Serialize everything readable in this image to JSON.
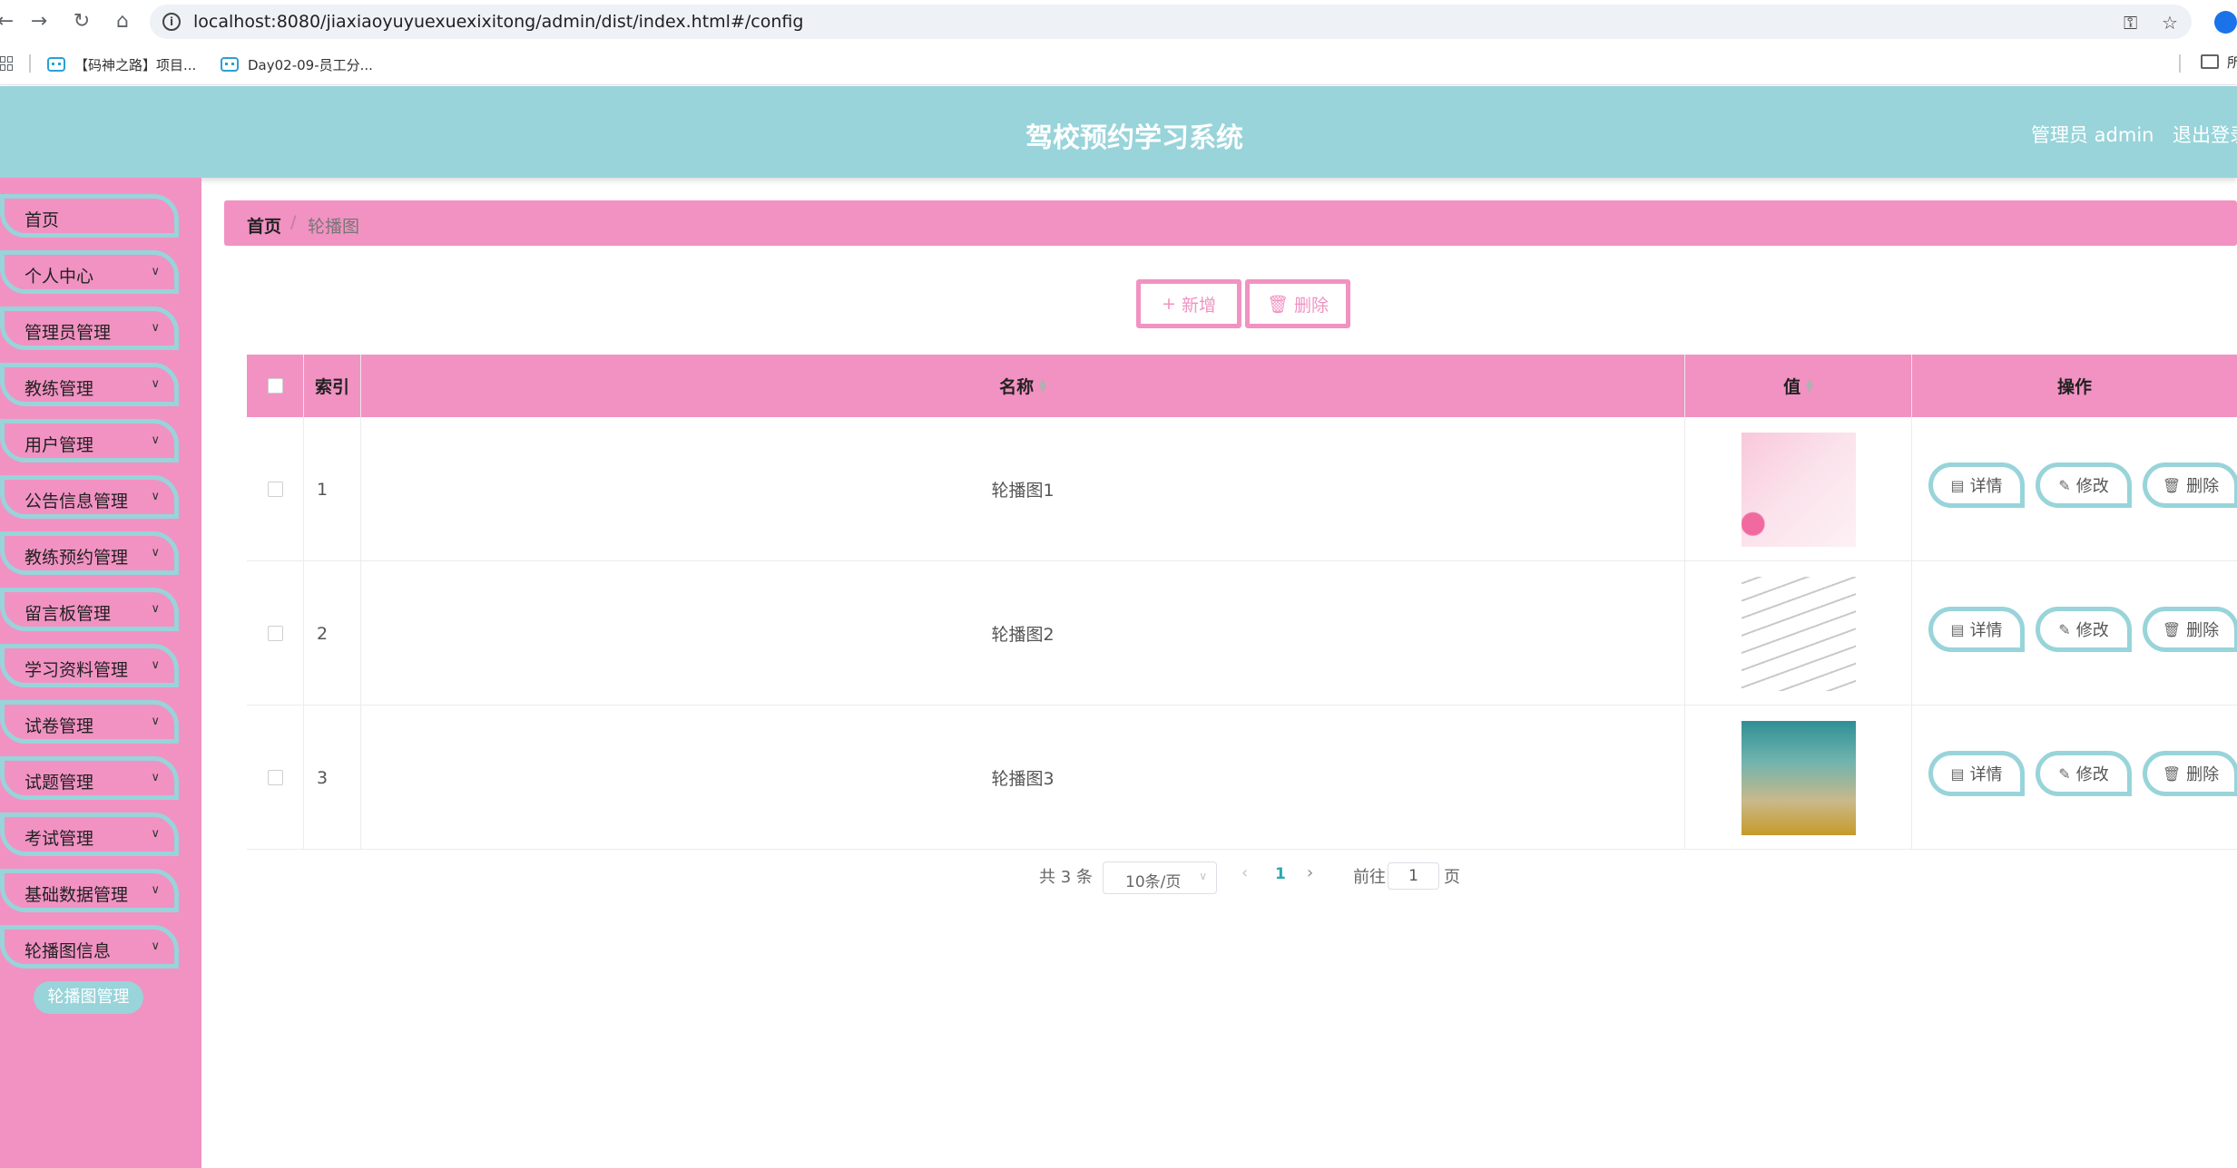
{
  "browser": {
    "url": "localhost:8080/jiaxiaoyuyuexuexixitong/admin/dist/index.html#/config",
    "bookmarks": [
      "【码神之路】项目...",
      "Day02-09-员工分..."
    ],
    "folder_label": "所"
  },
  "header": {
    "title": "驾校预约学习系统",
    "admin_label": "管理员 admin",
    "logout": "退出登录"
  },
  "sidebar": {
    "items": [
      {
        "label": "首页",
        "has_children": false
      },
      {
        "label": "个人中心",
        "has_children": true
      },
      {
        "label": "管理员管理",
        "has_children": true
      },
      {
        "label": "教练管理",
        "has_children": true
      },
      {
        "label": "用户管理",
        "has_children": true
      },
      {
        "label": "公告信息管理",
        "has_children": true
      },
      {
        "label": "教练预约管理",
        "has_children": true
      },
      {
        "label": "留言板管理",
        "has_children": true
      },
      {
        "label": "学习资料管理",
        "has_children": true
      },
      {
        "label": "试卷管理",
        "has_children": true
      },
      {
        "label": "试题管理",
        "has_children": true
      },
      {
        "label": "考试管理",
        "has_children": true
      },
      {
        "label": "基础数据管理",
        "has_children": true
      },
      {
        "label": "轮播图信息",
        "has_children": true
      }
    ],
    "submenu_active": "轮播图管理"
  },
  "breadcrumb": {
    "home": "首页",
    "separator": "/",
    "current": "轮播图"
  },
  "toolbar": {
    "add_label": "新增",
    "delete_label": "删除"
  },
  "table": {
    "columns": {
      "index": "索引",
      "name": "名称",
      "value": "值",
      "actions": "操作"
    },
    "rows": [
      {
        "index": "1",
        "name": "轮播图1",
        "thumb": "pink-floral"
      },
      {
        "index": "2",
        "name": "轮播图2",
        "thumb": "music-notes"
      },
      {
        "index": "3",
        "name": "轮播图3",
        "thumb": "teal-gold-texture"
      }
    ],
    "row_actions": {
      "detail": "详情",
      "edit": "修改",
      "delete": "删除"
    }
  },
  "pagination": {
    "total": "共 3 条",
    "page_size": "10条/页",
    "current_page": "1",
    "goto_prefix": "前往",
    "goto_value": "1",
    "goto_suffix": "页"
  },
  "colors": {
    "pink": "#f192c2",
    "teal": "#98d4da",
    "active_page": "#2aa8b0"
  }
}
